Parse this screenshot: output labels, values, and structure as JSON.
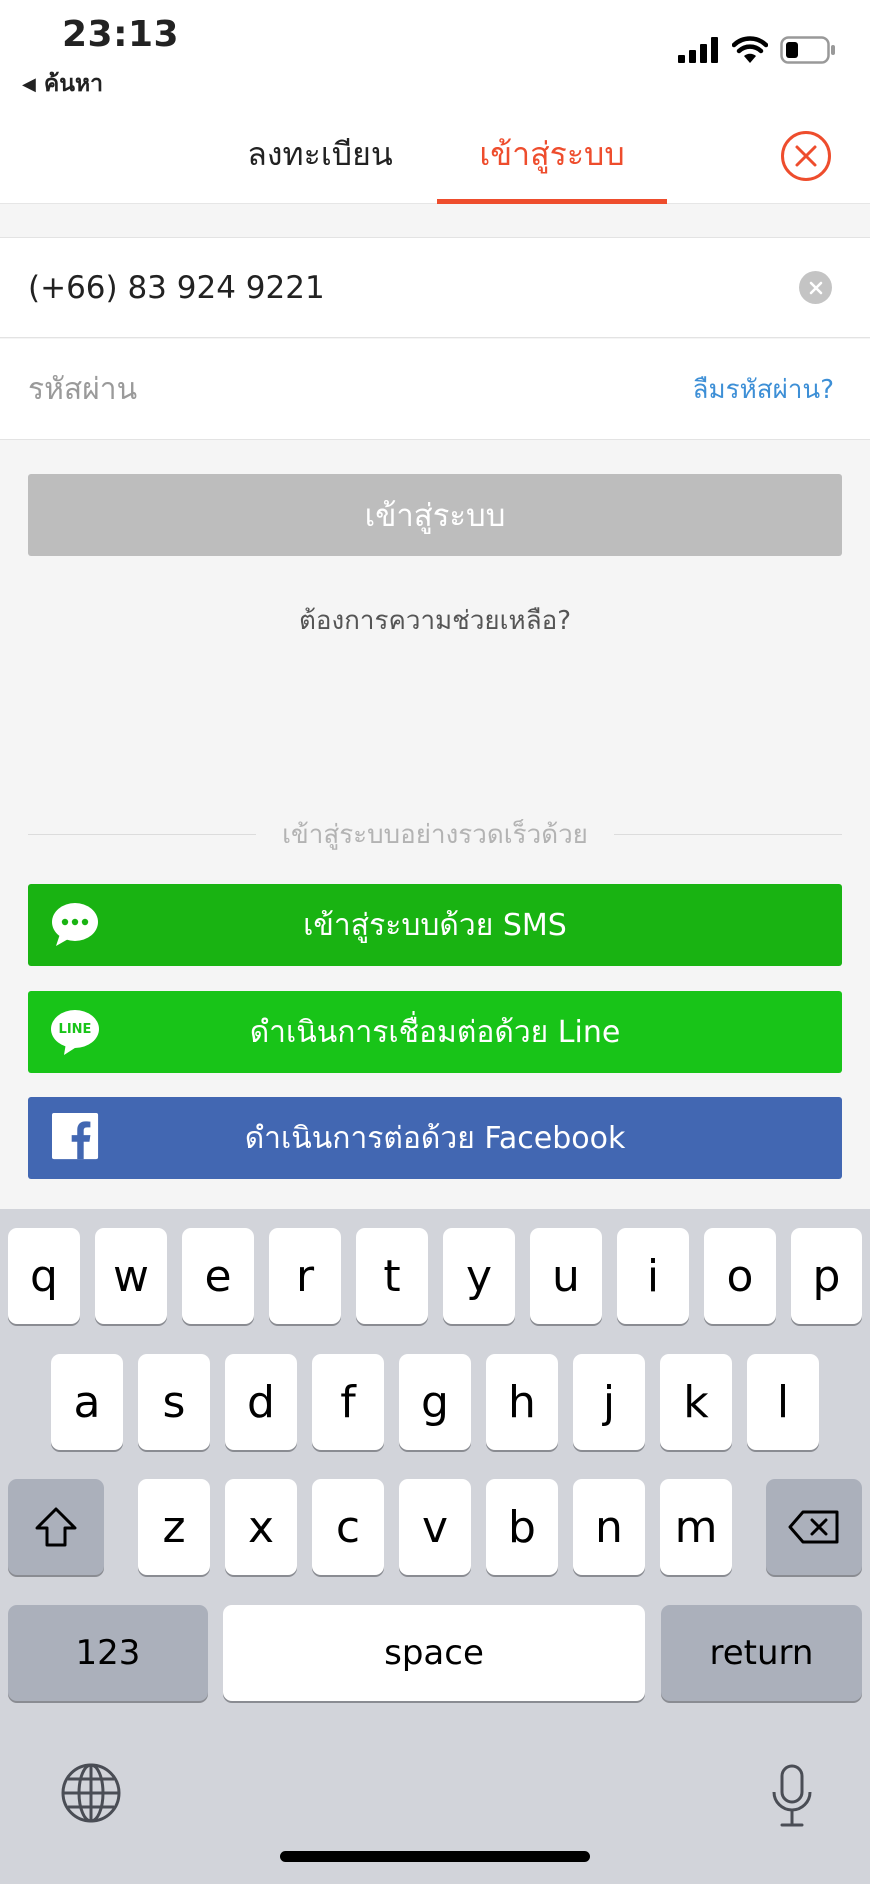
{
  "status_bar": {
    "time": "23:13",
    "back_label": "ค้นหา",
    "icons": [
      "signal-icon",
      "wifi-icon",
      "battery-icon"
    ]
  },
  "tabs": {
    "register": "ลงทะเบียน",
    "login": "เข้าสู่ระบบ",
    "active": "login"
  },
  "form": {
    "phone_value": "(+66) 83 924 9221",
    "password_placeholder": "รหัสผ่าน",
    "forgot_password": "ลืมรหัสผ่าน?",
    "login_button": "เข้าสู่ระบบ",
    "help": "ต้องการความช่วยเหลือ?"
  },
  "quick_login": {
    "divider": "เข้าสู่ระบบอย่างรวดเร็วด้วย",
    "sms": "เข้าสู่ระบบด้วย SMS",
    "line": "ดำเนินการเชื่อมต่อด้วย Line",
    "line_badge": "LINE",
    "facebook": "ดำเนินการต่อด้วย Facebook"
  },
  "keyboard": {
    "row1": [
      "q",
      "w",
      "e",
      "r",
      "t",
      "y",
      "u",
      "i",
      "o",
      "p"
    ],
    "row2": [
      "a",
      "s",
      "d",
      "f",
      "g",
      "h",
      "j",
      "k",
      "l"
    ],
    "row3": [
      "z",
      "x",
      "c",
      "v",
      "b",
      "n",
      "m"
    ],
    "numbers": "123",
    "space": "space",
    "return": "return"
  },
  "colors": {
    "accent": "#ee4d2d",
    "link": "#3d8fd6",
    "sms_green": "#19b312",
    "line_green": "#18c418",
    "facebook_blue": "#4267b2",
    "disabled_button": "#bdbdbd"
  }
}
